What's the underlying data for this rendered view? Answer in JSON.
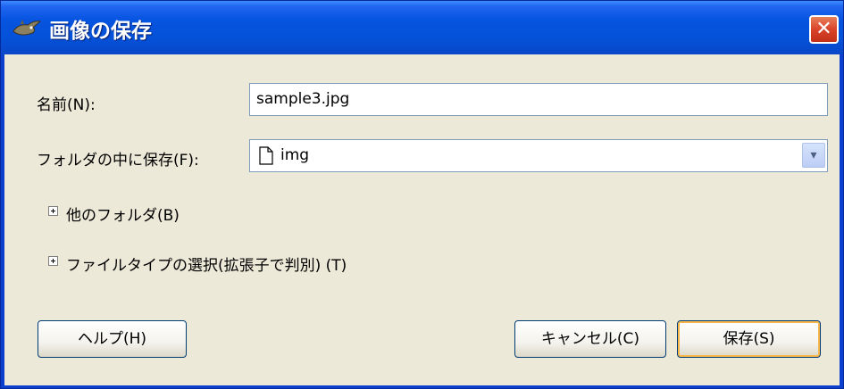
{
  "window": {
    "title": "画像の保存",
    "close_glyph": "✕",
    "icon": "gimp-wilber-icon"
  },
  "form": {
    "name_label": "名前(N):",
    "name_value": "sample3.jpg",
    "folder_label": "フォルダの中に保存(F):",
    "folder_value": "img",
    "folder_icon": "file-icon",
    "dropdown_glyph": "▾"
  },
  "expanders": {
    "other_folders": "他のフォルダ(B)",
    "file_type": "ファイルタイプの選択(拡張子で判別) (T)"
  },
  "buttons": {
    "help": "ヘルプ(H)",
    "cancel": "キャンセル(C)",
    "save": "保存(S)"
  },
  "colors": {
    "titlebar": "#0452d8",
    "client_bg": "#ece9d8",
    "close_button": "#d9442a",
    "default_button_glow": "#f8b74a"
  }
}
